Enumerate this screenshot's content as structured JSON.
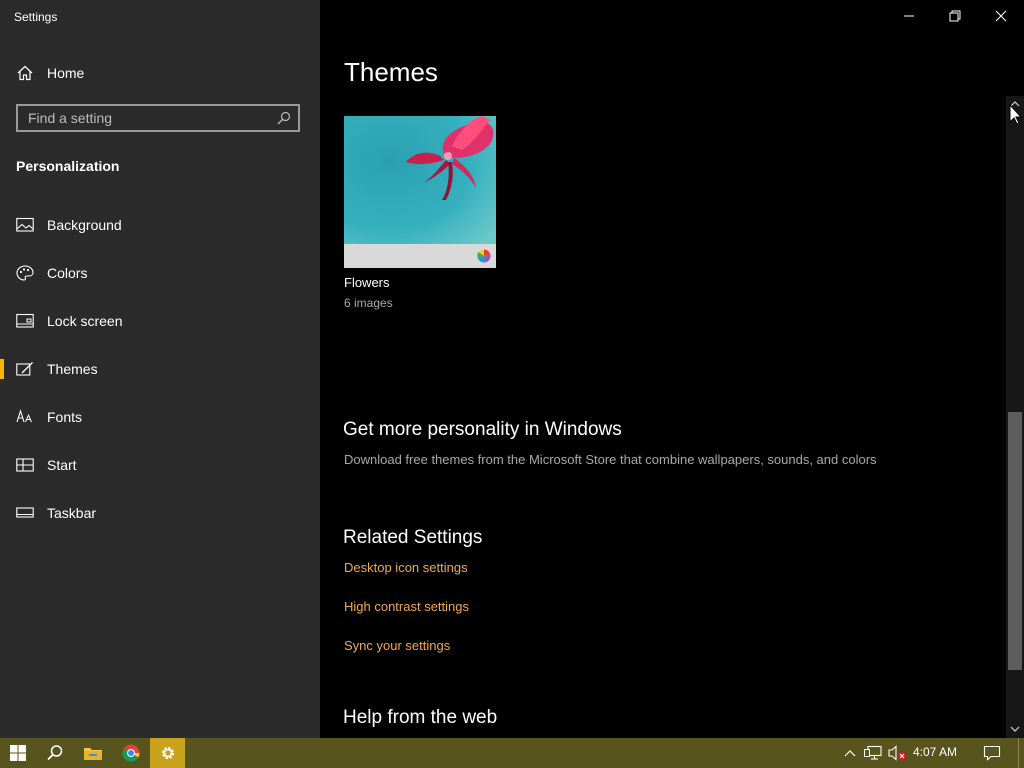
{
  "window": {
    "title": "Settings"
  },
  "sidebar": {
    "home_label": "Home",
    "search_placeholder": "Find a setting",
    "section_title": "Personalization",
    "items": [
      {
        "label": "Background",
        "icon": "picture-icon"
      },
      {
        "label": "Colors",
        "icon": "palette-icon"
      },
      {
        "label": "Lock screen",
        "icon": "lock-screen-icon"
      },
      {
        "label": "Themes",
        "icon": "themes-icon",
        "active": true
      },
      {
        "label": "Fonts",
        "icon": "fonts-icon"
      },
      {
        "label": "Start",
        "icon": "start-icon"
      },
      {
        "label": "Taskbar",
        "icon": "taskbar-icon"
      }
    ]
  },
  "main": {
    "title": "Themes",
    "theme": {
      "name": "Flowers",
      "count": "6 images"
    },
    "more": {
      "heading": "Get more personality in Windows",
      "description": "Download free themes from the Microsoft Store that combine wallpapers, sounds, and colors"
    },
    "related": {
      "heading": "Related Settings",
      "links": [
        "Desktop icon settings",
        "High contrast settings",
        "Sync your settings"
      ]
    },
    "help_heading": "Help from the web"
  },
  "taskbar": {
    "time": "4:07 AM"
  },
  "colors": {
    "accent": "#f7b500",
    "link": "#f2a94a",
    "sidebar_bg": "#2b2b2b",
    "taskbar_bg": "#57551d"
  }
}
